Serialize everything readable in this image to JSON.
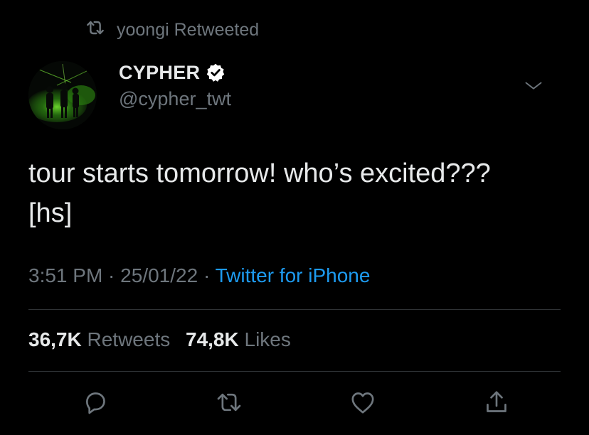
{
  "retweet_context": {
    "icon": "retweet-icon",
    "text": "yoongi Retweeted"
  },
  "author": {
    "display_name": "CYPHER",
    "verified": true,
    "handle": "@cypher_twt",
    "avatar": "concert-stage-avatar"
  },
  "tweet": {
    "text": "tour starts tomorrow! who’s excited???\n[hs]"
  },
  "meta": {
    "time": "3:51 PM",
    "sep1": " · ",
    "date": "25/01/22",
    "sep2": " · ",
    "source": "Twitter for iPhone"
  },
  "stats": {
    "retweets_count": "36,7K",
    "retweets_label": "Retweets",
    "likes_count": "74,8K",
    "likes_label": "Likes"
  },
  "actions": [
    "reply-icon",
    "retweet-icon",
    "like-icon",
    "share-icon"
  ],
  "colors": {
    "background": "#000000",
    "text_primary": "#e7e9ea",
    "text_secondary": "#6e767d",
    "link": "#1d9bf0",
    "divider": "#2f3336"
  }
}
